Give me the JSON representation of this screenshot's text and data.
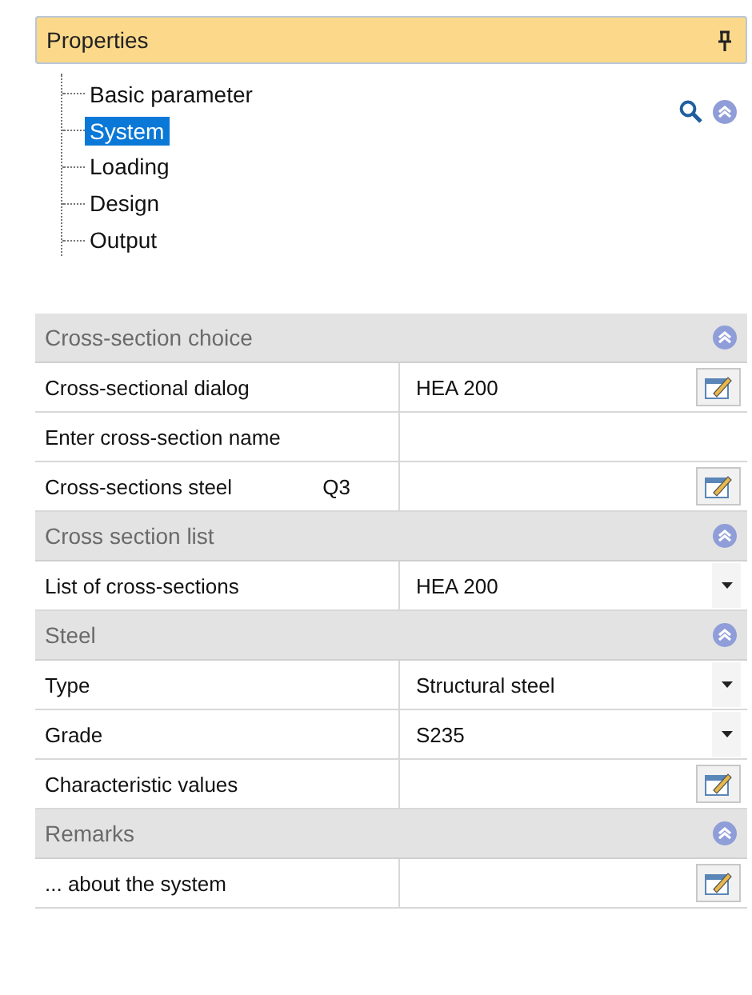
{
  "panel": {
    "title": "Properties"
  },
  "tree": [
    {
      "label": "Basic parameter",
      "selected": false
    },
    {
      "label": "System",
      "selected": true
    },
    {
      "label": "Loading",
      "selected": false
    },
    {
      "label": "Design",
      "selected": false
    },
    {
      "label": "Output",
      "selected": false
    }
  ],
  "sections": [
    {
      "title": "Cross-section choice",
      "expanded": true,
      "rows": [
        {
          "label": "Cross-sectional dialog",
          "value": "HEA 200",
          "kind": "edit"
        },
        {
          "label": "Enter cross-section name",
          "kind": "text"
        },
        {
          "label": "Cross-sections steel",
          "suffix": "Q3",
          "kind": "edit"
        }
      ]
    },
    {
      "title": "Cross section list",
      "expanded": true,
      "rows": [
        {
          "label": "List of cross-sections",
          "value": "HEA 200",
          "kind": "dropdown"
        }
      ]
    },
    {
      "title": "Steel",
      "expanded": true,
      "rows": [
        {
          "label": "Type",
          "value": "Structural steel",
          "kind": "dropdown"
        },
        {
          "label": "Grade",
          "value": "S235",
          "kind": "dropdown"
        },
        {
          "label": "Characteristic values",
          "kind": "edit"
        }
      ]
    },
    {
      "title": "Remarks",
      "expanded": true,
      "rows": [
        {
          "label": "... about the system",
          "kind": "edit"
        }
      ]
    }
  ]
}
